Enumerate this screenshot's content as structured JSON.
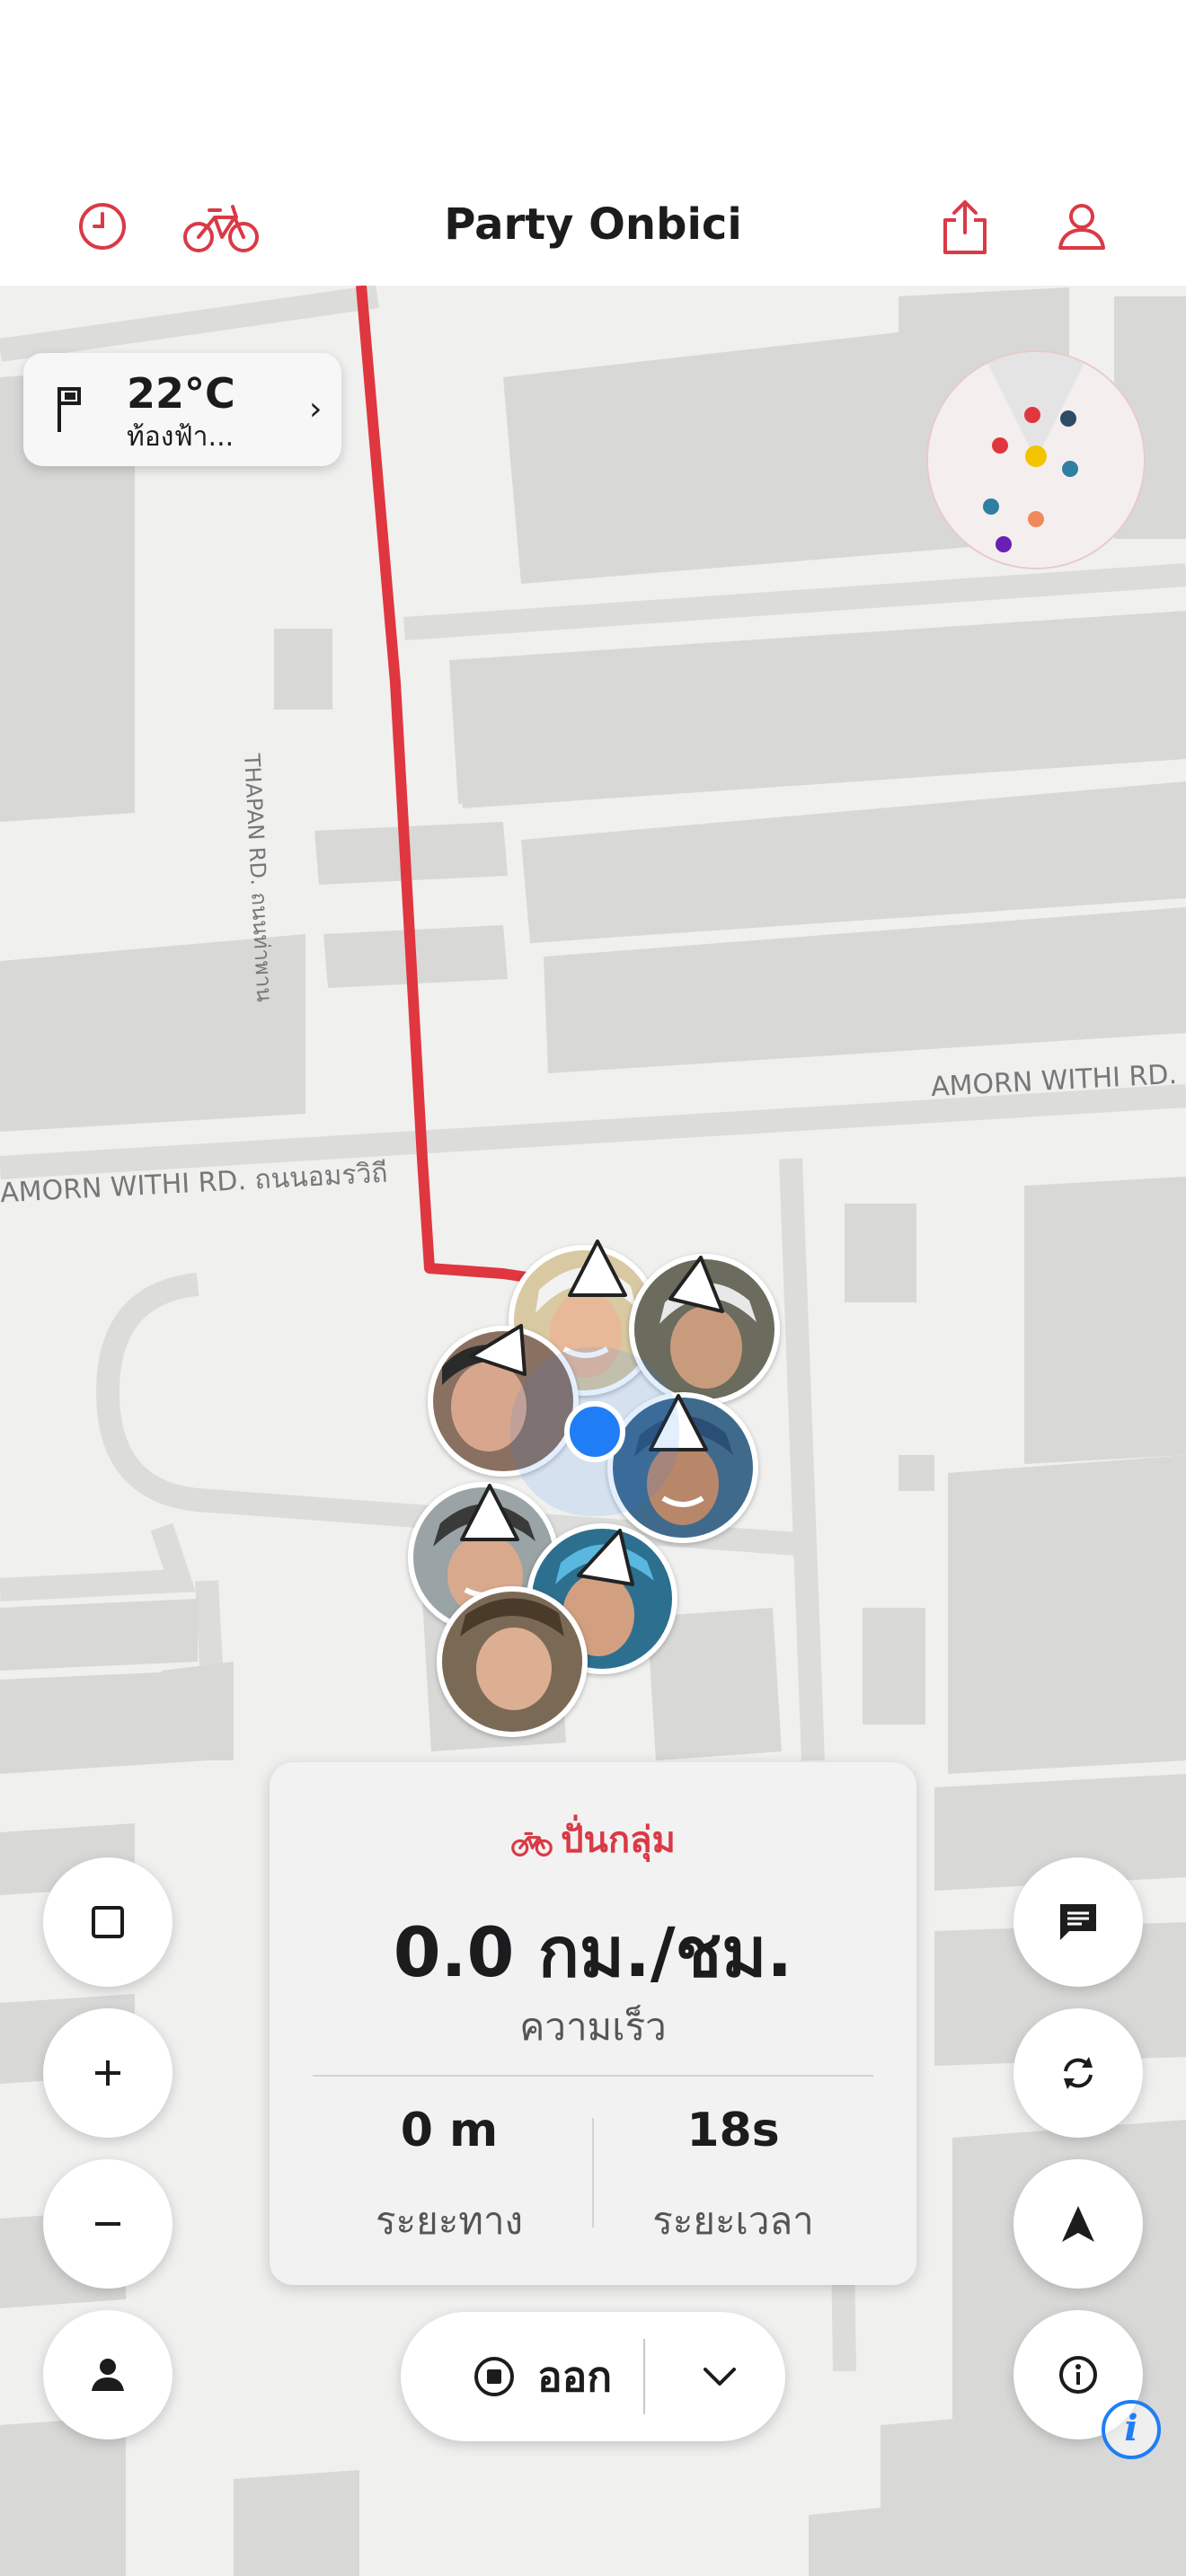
{
  "header": {
    "title": "Party Onbici",
    "left_icons": [
      "clock-icon",
      "bicycle-icon"
    ],
    "right_icons": [
      "share-icon",
      "profile-icon"
    ]
  },
  "weather": {
    "temperature": "22°C",
    "condition": "ท้องฟ้า...",
    "icon": "flag-icon"
  },
  "map": {
    "street_labels": [
      "AMORN WITHI RD.",
      "AMORN WITHI RD. ถนนอมรวิถี",
      "THAPAN RD. ถนนท่าพาน"
    ],
    "route_color": "#e0363f",
    "user_location_color": "#1f7ef5",
    "rider_count": 7
  },
  "radar": {
    "dot_colors": [
      "#e0363f",
      "#2d4a66",
      "#e0363f",
      "#f2c500",
      "#2e7fa3",
      "#2e7fa3",
      "#f08a5d",
      "#6a1fb5"
    ]
  },
  "stats": {
    "mode_label": "ปั่นกลุ่ม",
    "speed": "0.0 กม./ชม.",
    "speed_label": "ความเร็ว",
    "distance_value": "0 m",
    "distance_label": "ระยะทาง",
    "time_value": "18s",
    "time_label": "ระยะเวลา"
  },
  "controls": {
    "left": [
      "stop-square-icon",
      "zoom-in-icon",
      "zoom-out-icon",
      "person-icon"
    ],
    "right": [
      "chat-icon",
      "refresh-icon",
      "navigate-icon",
      "info-icon"
    ]
  },
  "exit_button": {
    "label": "ออก",
    "icon": "stop-circle-icon",
    "more_icon": "chevron-down-icon"
  },
  "attribution_icon": "info-icon"
}
